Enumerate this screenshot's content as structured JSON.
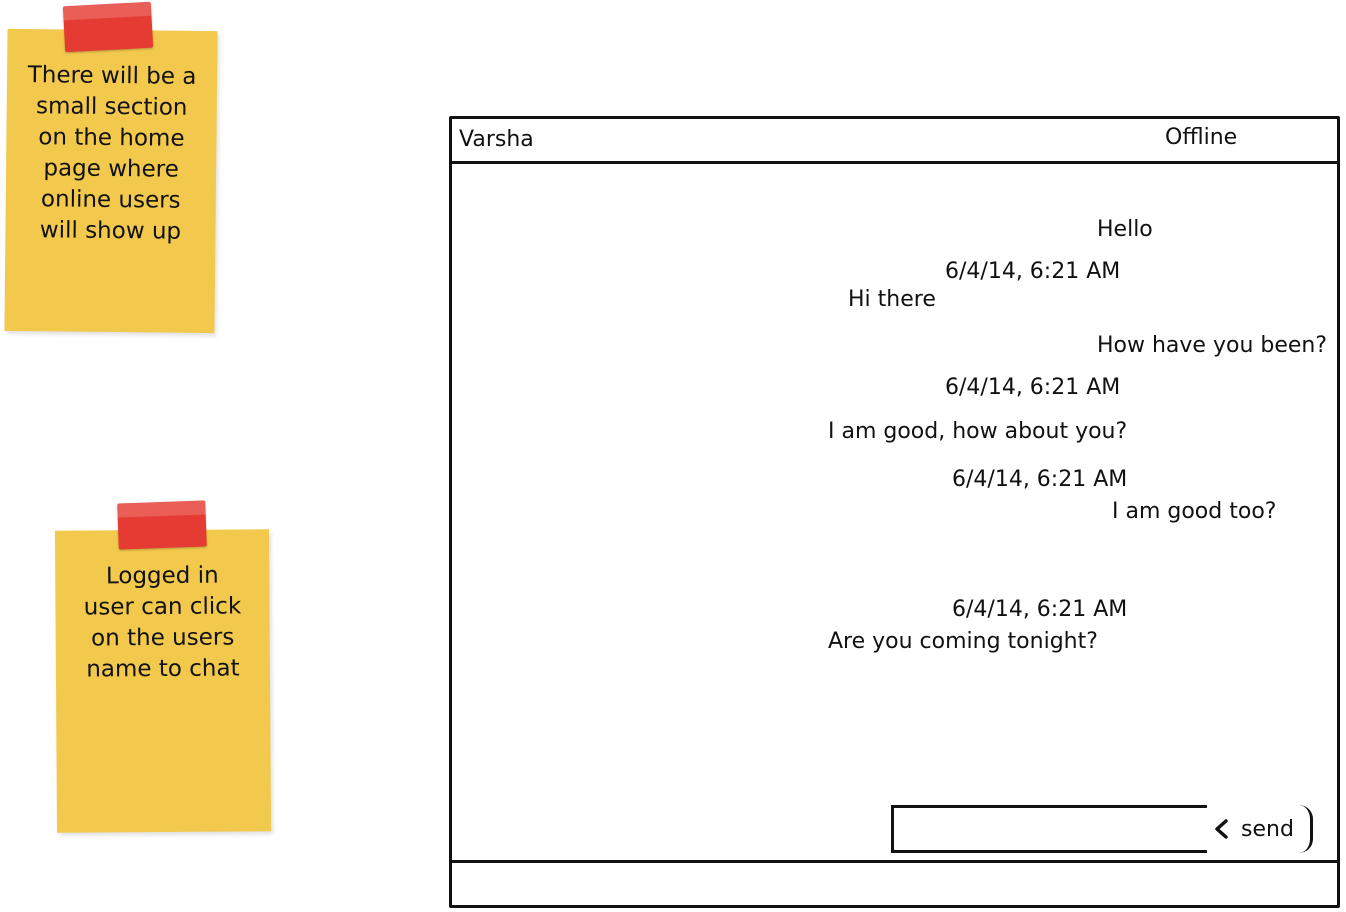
{
  "sticky_notes": [
    {
      "lines": [
        "There will be a",
        "small section",
        "on the home",
        "page where",
        "online users",
        "will show up"
      ]
    },
    {
      "lines": [
        "Logged in",
        "user can click",
        "on the users",
        "name to chat"
      ]
    }
  ],
  "chat": {
    "contact_name": "Varsha",
    "status": "Offline",
    "messages": [
      {
        "text": "Hello"
      },
      {
        "text": "6/4/14, 6:21 AM"
      },
      {
        "text": "Hi there"
      },
      {
        "text": "How have you been?"
      },
      {
        "text": "6/4/14, 6:21 AM"
      },
      {
        "text": "I am good, how about you?"
      },
      {
        "text": "6/4/14, 6:21 AM"
      },
      {
        "text": "I am good too?"
      },
      {
        "text": "6/4/14, 6:21 AM"
      },
      {
        "text": "Are you coming tonight?"
      }
    ],
    "input": {
      "value": "",
      "placeholder": ""
    },
    "send_label": "send",
    "send_icon": "chevron-left-icon"
  }
}
